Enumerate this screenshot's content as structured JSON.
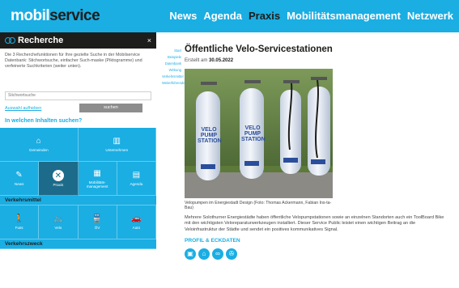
{
  "brand": {
    "part1": "mobil",
    "part2": "service"
  },
  "nav": [
    "News",
    "Agenda",
    "Praxis",
    "Mobilitätsmanagement",
    "Netzwerk"
  ],
  "panel": {
    "title": "Recherche",
    "close": "×",
    "intro": "Die 3 Recherchefunktionen für Ihre gezielte Suche in der Mobilservice Datenbank: Stichwortsuche, einfacher Such-maske (Piktogramme) und verfeinerte Suchkriterien (weiter unten).",
    "search_placeholder": "Stichwortsuche",
    "reset_label": "Auswahl aufheben",
    "search_button": "suchen",
    "question": "In welchen Inhalten suchen?",
    "row1": [
      {
        "icon": "⌂",
        "label": "Gemeinden"
      },
      {
        "icon": "▥",
        "label": "Unternehmen"
      }
    ],
    "row2": [
      {
        "icon": "✎",
        "label": "News"
      },
      {
        "icon": "✕",
        "label": "Praxis"
      },
      {
        "icon": "▦",
        "label": "Mobilitäts-management"
      },
      {
        "icon": "▤",
        "label": "Agenda"
      }
    ],
    "category1": "Verkehrsmittel",
    "row3": [
      {
        "icon": "🚶",
        "label": "Fuss"
      },
      {
        "icon": "🚲",
        "label": "Velo"
      },
      {
        "icon": "🚆",
        "label": "ÖV"
      },
      {
        "icon": "🚗",
        "label": "Auto"
      }
    ],
    "category2": "Verkehrszweck"
  },
  "subnav": [
    "Start",
    "Beispiele",
    "Datenbank",
    "Wirkung",
    "Verkehrsmittel",
    "Weiterführendes"
  ],
  "article": {
    "title": "Öffentliche Velo-Servicestationen",
    "date_prefix": "Erstellt am",
    "date": "30.05.2022",
    "station_text": "VELO PUMP STATION",
    "caption": "Velopumpen im Energiestadt Design (Foto: Thomas Ackermann, Fabian Ins-ta-Bau)",
    "body": "Mehrere Solothurner Energiestädte haben öffentliche Velopumpstationen sowie an einzelnen Standorten auch ein ToolBoard Bike mit den wichtigsten Veloreparaturwerkzeugen installiert. Dieser Service Public leistet einen wichtigen Beitrag an die Veloinfrastruktur der Städte und sendet ein positives kommunikatives Signal.",
    "profile_label": "PROFIL & ECKDATEN",
    "profile_icons": [
      "bus-icon",
      "home-icon",
      "bike-icon",
      "pump-icon"
    ]
  },
  "colors": {
    "accent": "#1aaee3",
    "dark": "#1d1d1b",
    "active_tile": "#1d6b8a"
  }
}
